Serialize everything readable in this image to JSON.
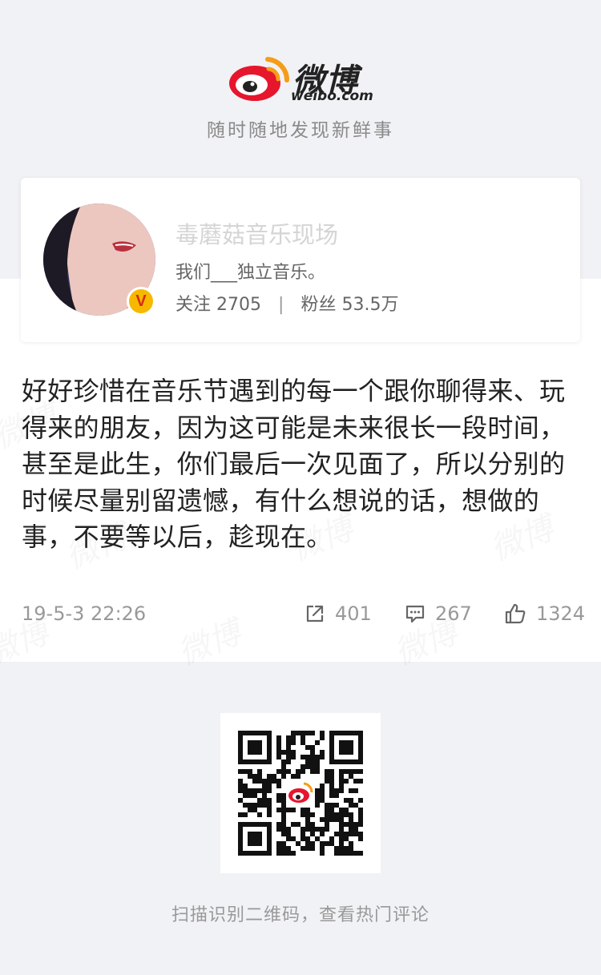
{
  "header": {
    "logo_cn": "微博",
    "logo_en": "weibo.com",
    "slogan": "随时随地发现新鲜事"
  },
  "profile": {
    "name": "毒蘑菇音乐现场",
    "bio": "我们___独立音乐。",
    "following_label": "关注",
    "following_count": "2705",
    "separator": "|",
    "followers_label": "粉丝",
    "followers_count": "53.5万",
    "verified_badge": "V"
  },
  "post": {
    "text": "好好珍惜在音乐节遇到的每一个跟你聊得来、玩得来的朋友，因为这可能是未来很长一段时间，甚至是此生，你们最后一次见面了，所以分别的时候尽量别留遗憾，有什么想说的话，想做的事，不要等以后，趁现在。",
    "time": "19-5-3 22:26",
    "shares": "401",
    "comments": "267",
    "likes": "1324"
  },
  "qr": {
    "caption": "扫描识别二维码，查看热门评论"
  },
  "icons": {
    "share": "share-icon",
    "comment": "comment-icon",
    "like": "thumbs-up-icon",
    "logo": "weibo-logo-icon"
  },
  "colors": {
    "brand_red": "#e6162d",
    "brand_orange": "#f59d19",
    "badge_gold": "#f7b800",
    "background": "#f1f2f5"
  }
}
